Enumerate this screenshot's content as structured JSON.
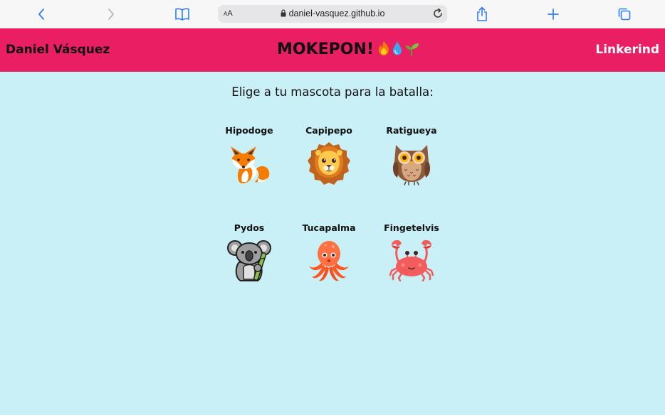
{
  "browser": {
    "text_size_label_big": "A",
    "text_size_label_small": "A",
    "url": "daniel-vasquez.github.io",
    "icons": [
      "back-icon",
      "forward-icon",
      "bookmarks-icon",
      "lock-icon",
      "reload-icon",
      "share-icon",
      "new-tab-icon",
      "tabs-icon"
    ],
    "accent_color": "#2f7ef6"
  },
  "header": {
    "author": "Daniel Vásquez",
    "title": "MOKEPON!",
    "title_icons": [
      "fire-icon",
      "water-drop-icon",
      "seedling-icon"
    ],
    "link": "Linkerind",
    "background_color": "#e91e63"
  },
  "main": {
    "prompt": "Elige a tu mascota para la batalla:",
    "background_color": "#c9eff7",
    "pets": [
      {
        "name": "Hipodoge",
        "icon": "fox-icon"
      },
      {
        "name": "Capipepo",
        "icon": "lion-icon"
      },
      {
        "name": "Ratigueya",
        "icon": "owl-icon"
      },
      {
        "name": "Pydos",
        "icon": "koala-icon"
      },
      {
        "name": "Tucapalma",
        "icon": "octopus-icon"
      },
      {
        "name": "Fingetelvis",
        "icon": "crab-icon"
      }
    ]
  }
}
